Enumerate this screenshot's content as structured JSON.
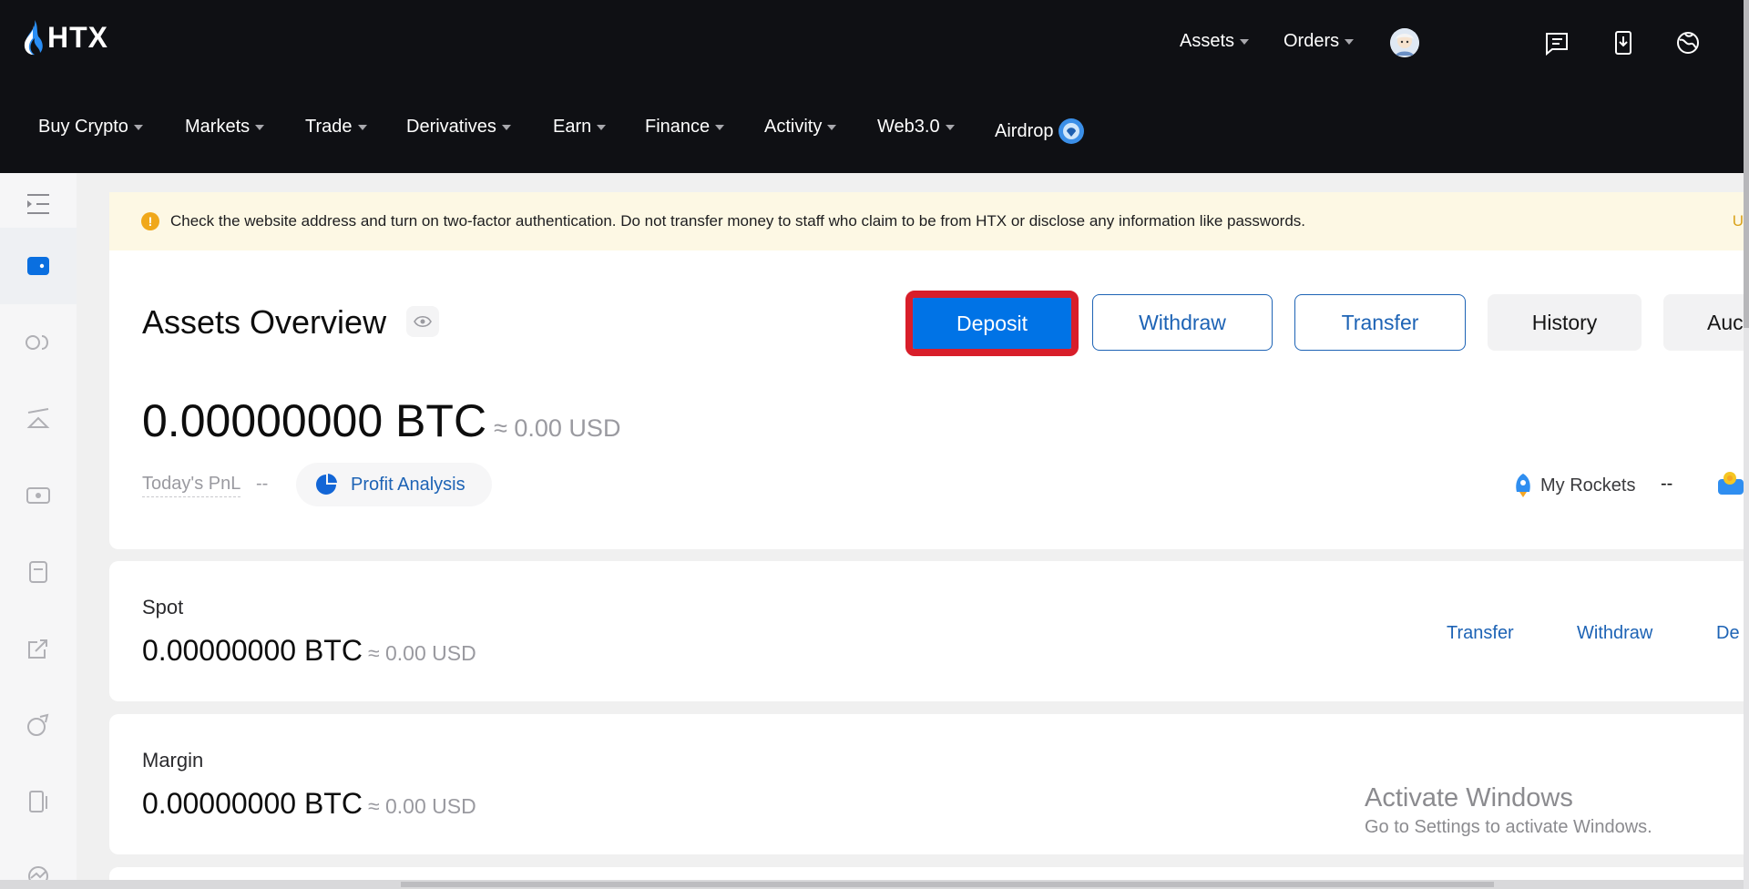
{
  "header": {
    "brand": "HTX",
    "top_menu": [
      {
        "label": "Assets"
      },
      {
        "label": "Orders"
      }
    ],
    "icons": [
      "avatar",
      "orders-list-icon",
      "download-app-icon",
      "language-globe-icon"
    ]
  },
  "nav": [
    {
      "label": "Buy Crypto"
    },
    {
      "label": "Markets"
    },
    {
      "label": "Trade"
    },
    {
      "label": "Derivatives"
    },
    {
      "label": "Earn"
    },
    {
      "label": "Finance"
    },
    {
      "label": "Activity"
    },
    {
      "label": "Web3.0"
    },
    {
      "label": "Airdrop"
    }
  ],
  "sidebar": {
    "icons": [
      "menu-collapse-icon",
      "wallet-icon",
      "toggle-icon",
      "margin-icon",
      "futures-icon",
      "order-icon",
      "export-icon",
      "earn-icon",
      "device-icon",
      "chart-icon"
    ]
  },
  "notice": {
    "text": "Check the website address and turn on two-factor authentication. Do not transfer money to staff who claim to be from HTX or disclose any information like passwords.",
    "more": "U"
  },
  "overview": {
    "title": "Assets Overview",
    "buttons": {
      "deposit": "Deposit",
      "withdraw": "Withdraw",
      "transfer": "Transfer",
      "history": "History",
      "more": "Auc"
    },
    "balance": "0.00000000 BTC",
    "balance_usd": "≈ 0.00 USD",
    "pnl_label": "Today's PnL",
    "pnl_value": "--",
    "profit_analysis": "Profit Analysis",
    "rockets_label": "My Rockets",
    "rockets_value": "--"
  },
  "accounts": [
    {
      "name": "Spot",
      "balance": "0.00000000 BTC",
      "balance_usd": "≈ 0.00 USD",
      "links": {
        "transfer": "Transfer",
        "withdraw": "Withdraw",
        "deposit": "De"
      }
    },
    {
      "name": "Margin",
      "balance": "0.00000000 BTC",
      "balance_usd": "≈ 0.00 USD"
    }
  ],
  "watermark": {
    "line1": "Activate Windows",
    "line2": "Go to Settings to activate Windows."
  },
  "colors": {
    "header_bg": "#0f1014",
    "accent": "#0073e6",
    "link": "#1d63b5",
    "highlight": "#d81e2a",
    "notice_bg": "#fdf8e4"
  }
}
